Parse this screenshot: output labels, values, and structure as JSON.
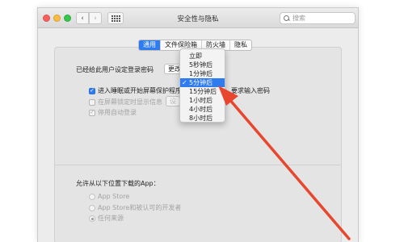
{
  "window": {
    "title": "安全性与隐私",
    "search_placeholder": "搜索"
  },
  "tabs": [
    {
      "label": "通用",
      "active": true
    },
    {
      "label": "文件保险箱",
      "active": false
    },
    {
      "label": "防火墙",
      "active": false
    },
    {
      "label": "隐私",
      "active": false
    }
  ],
  "general": {
    "login_password_label": "已经给此用户设定登录密码",
    "change_password_button": "更改",
    "require_password_label": "进入睡眠或开始屏幕保护程序",
    "require_password_suffix": "要求输入密码",
    "show_message_label": "在屏幕锁定时显示信息",
    "set_message_button": "设",
    "disable_auto_login_label": "停用自动登录"
  },
  "dropdown": {
    "items": [
      "立即",
      "5秒钟后",
      "1分钟后",
      "5分钟后",
      "15分钟后",
      "1小时后",
      "4小时后",
      "8小时后"
    ],
    "selected": "5分钟后"
  },
  "downloads": {
    "heading": "允许从以下位置下载的App：",
    "options": [
      "App Store",
      "App Store和被认可的开发者",
      "任何来源"
    ],
    "selected": "任何来源"
  },
  "colors": {
    "accent": "#2f7bf0",
    "arrow": "#e8472f"
  }
}
